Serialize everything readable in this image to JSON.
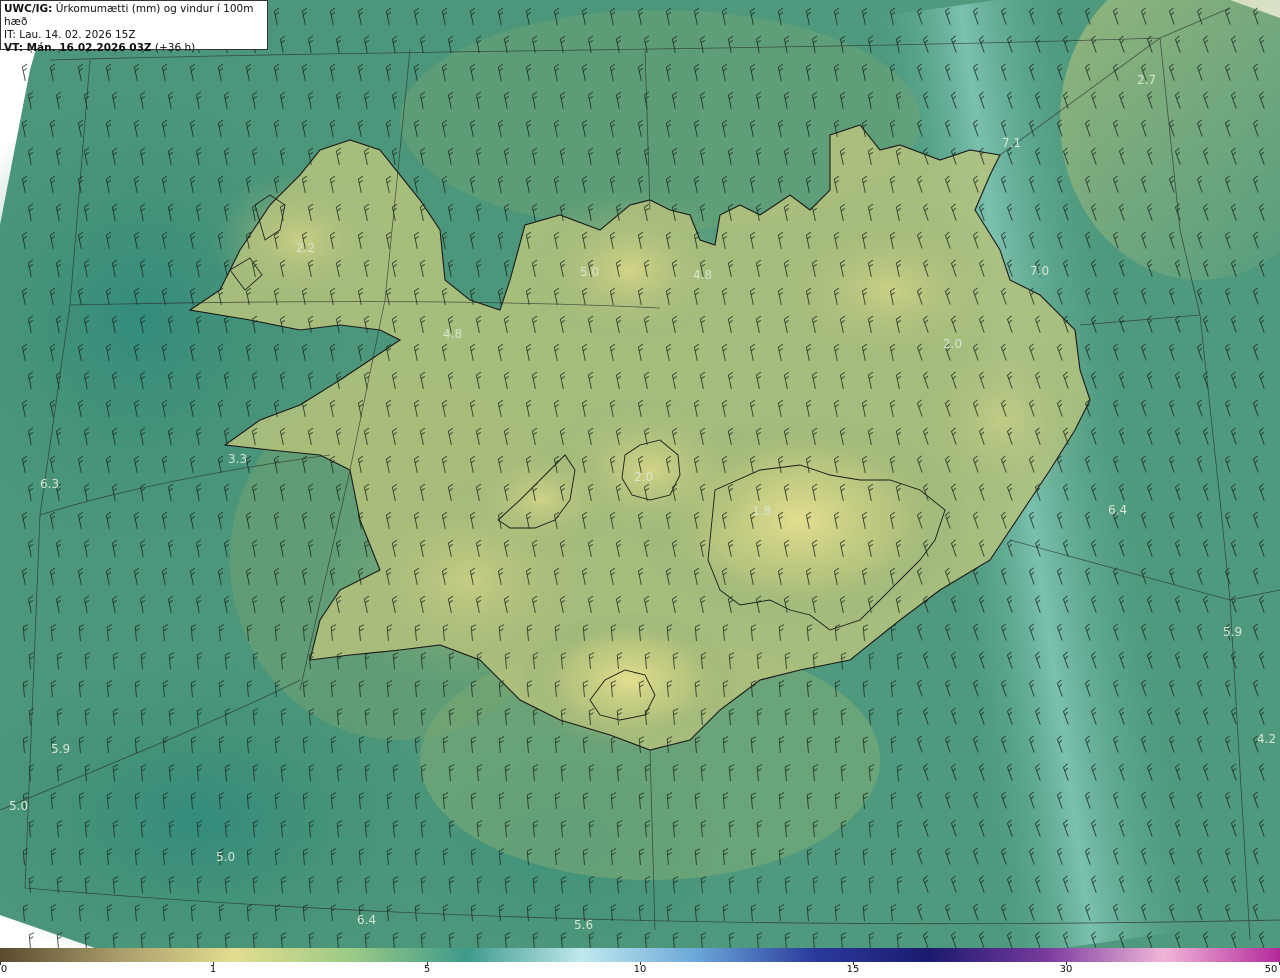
{
  "header": {
    "line1_prefix": "UWC/IG:",
    "line1_text": " Úrkomumætti (mm) og vindur í 100m hæð",
    "line2": "IT: Lau. 14. 02. 2026 15Z",
    "line3_prefix": "VT: Mán. 16.02.2026 03Z",
    "line3_text": " (+36 h)"
  },
  "map_labels": [
    "2.7",
    "7.1",
    "2.2",
    "5.0",
    "4.8",
    "7.0",
    "4.8",
    "2.0",
    "3.3",
    "6.3",
    "2.0",
    "1.8",
    "6.4",
    "5.9",
    "4.2",
    "5.9",
    "5.0",
    "5.0",
    "6.4",
    "5.6"
  ],
  "colorbar": {
    "ticks": [
      "0",
      "1",
      "5",
      "10",
      "15",
      "30",
      "50"
    ],
    "colors": [
      "#5b4a2e",
      "#a99a6a",
      "#e3dd8e",
      "#9ccb86",
      "#3e9a8a",
      "#bfe9ee",
      "#6aa6d8",
      "#2a3a9c",
      "#1b1a6e",
      "#7a3b9e",
      "#f0b6d8",
      "#b2299a"
    ]
  }
}
